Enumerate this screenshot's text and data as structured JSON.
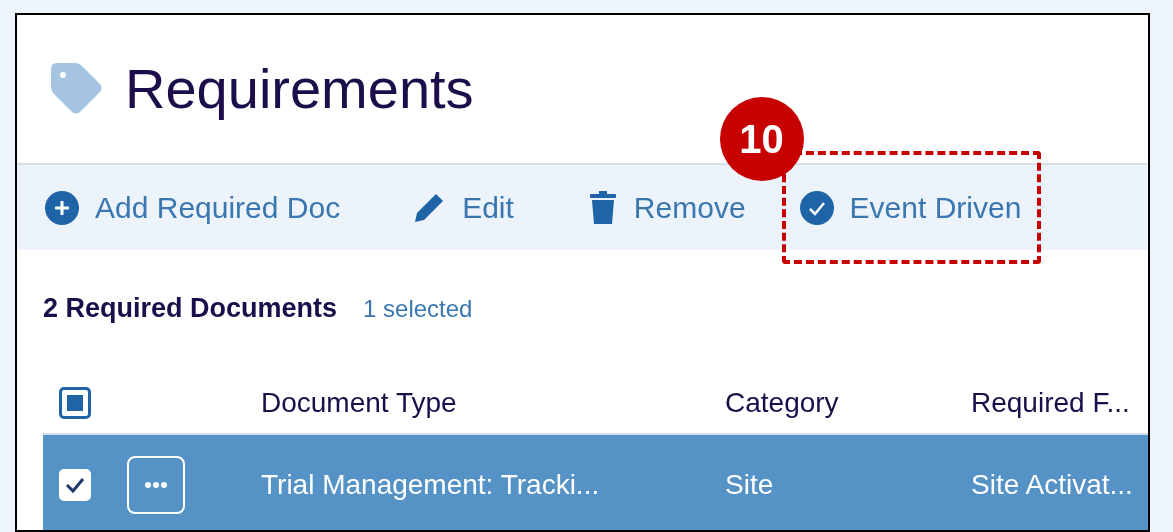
{
  "page": {
    "title": "Requirements"
  },
  "toolbar": [
    {
      "kind": "add",
      "label": "Add Required Doc",
      "highlighted": false
    },
    {
      "kind": "edit",
      "label": "Edit",
      "highlighted": false
    },
    {
      "kind": "remove",
      "label": "Remove",
      "highlighted": false
    },
    {
      "kind": "event",
      "label": "Event Driven",
      "highlighted": true
    }
  ],
  "callout": {
    "number": "10"
  },
  "summary": {
    "count": "2 Required Documents",
    "selection": "1 selected"
  },
  "table": {
    "select_all": {
      "checked": false,
      "indeterminate": true
    },
    "columns": [
      "Document Type",
      "Category",
      "Required F..."
    ],
    "rows": [
      {
        "selected": true,
        "checked": true,
        "cells": [
          "Trial Management: Tracki...",
          "Site",
          "Site Activat..."
        ]
      }
    ]
  }
}
